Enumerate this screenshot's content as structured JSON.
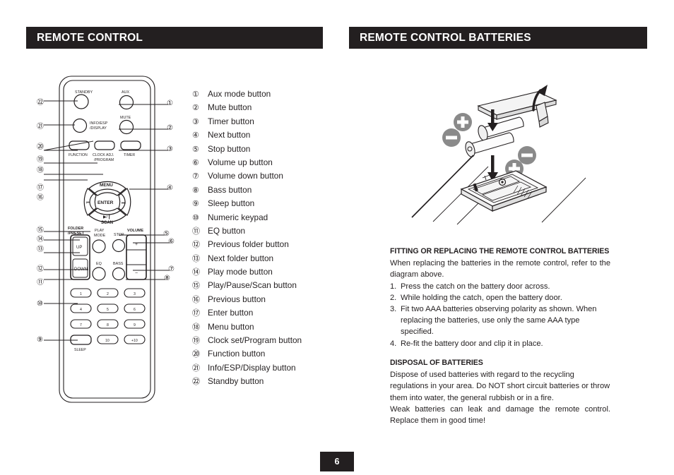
{
  "page": {
    "number": "6"
  },
  "sections": {
    "left_header": "REMOTE CONTROL",
    "right_header": "REMOTE CONTROL BATTERIES"
  },
  "legend": {
    "items": [
      {
        "num": "①",
        "label": "Aux mode button"
      },
      {
        "num": "②",
        "label": "Mute button"
      },
      {
        "num": "③",
        "label": "Timer button"
      },
      {
        "num": "④",
        "label": "Next button"
      },
      {
        "num": "⑤",
        "label": "Stop button"
      },
      {
        "num": "⑥",
        "label": "Volume up button"
      },
      {
        "num": "⑦",
        "label": "Volume down button"
      },
      {
        "num": "⑧",
        "label": "Bass button"
      },
      {
        "num": "⑨",
        "label": "Sleep button"
      },
      {
        "num": "⑩",
        "label": "Numeric keypad"
      },
      {
        "num": "⑪",
        "label": "EQ button"
      },
      {
        "num": "⑫",
        "label": "Previous folder button"
      },
      {
        "num": "⑬",
        "label": "Next folder button"
      },
      {
        "num": "⑭",
        "label": "Play mode button"
      },
      {
        "num": "⑮",
        "label": "Play/Pause/Scan button"
      },
      {
        "num": "⑯",
        "label": "Previous button"
      },
      {
        "num": "⑰",
        "label": "Enter button"
      },
      {
        "num": "⑱",
        "label": "Menu button"
      },
      {
        "num": "⑲",
        "label": "Clock set/Program button"
      },
      {
        "num": "⑳",
        "label": "Function button"
      },
      {
        "num": "㉑",
        "label": "Info/ESP/Display button"
      },
      {
        "num": "㉒",
        "label": "Standby button"
      }
    ]
  },
  "remote": {
    "buttons": {
      "standby": "STANDBY",
      "aux": "AUX",
      "info_display_line1": "INFO/ESP",
      "info_display_line2": "/DISPLAY",
      "mute": "MUTE",
      "function": "FUNCTION",
      "clock_line1": "CLOCK ADJ.",
      "clock_line2": "/PROGRAM",
      "timer": "TIMER",
      "menu": "MENU",
      "enter": "ENTER",
      "prev": "⏮",
      "next": "⏭",
      "play_pause": "▶/❙",
      "scan": "SCAN",
      "folder_line1": "FOLDER",
      "folder_line2": "/PRESET",
      "up": "UP",
      "down": "DOWN",
      "play_mode_line1": "PLAY",
      "play_mode_line2": "MODE",
      "stop": "STOP",
      "volume": "VOLUME",
      "vol_up": "+",
      "vol_down": "−",
      "eq": "EQ",
      "bass": "BASS",
      "sleep": "SLEEP",
      "key1": "1",
      "key2": "2",
      "key3": "3",
      "key4": "4",
      "key5": "5",
      "key6": "6",
      "key7": "7",
      "key8": "8",
      "key9": "9",
      "key10": "10",
      "keyplus10": "+10"
    },
    "callouts_left": [
      "㉒",
      "㉑",
      "⑳",
      "⑲",
      "⑱",
      "⑰",
      "⑯",
      "⑮",
      "⑭",
      "⑬",
      "⑫",
      "⑪",
      "⑩",
      "⑨"
    ],
    "callouts_right": [
      "①",
      "②",
      "③",
      "④",
      "⑤",
      "⑥",
      "⑦",
      "⑧"
    ]
  },
  "battery_diagram": {
    "plus_symbol": "+",
    "minus_symbol": "−"
  },
  "fitting": {
    "heading": "FITTING OR REPLACING THE REMOTE CONTROL BATTERIES",
    "intro": "When replacing the batteries in the remote control, refer to the diagram above.",
    "steps": [
      {
        "index": "1.",
        "text": "Press the catch on the battery door across."
      },
      {
        "index": "2.",
        "text": "While holding the catch, open the battery door."
      },
      {
        "index": "3.",
        "text": "Fit two AAA batteries observing polarity as shown. When replacing the batteries, use only the same AAA type specified."
      },
      {
        "index": "4.",
        "text": "Re-fit the battery door and clip it in place."
      }
    ]
  },
  "disposal": {
    "heading": "DISPOSAL OF BATTERIES",
    "paragraph1": "Dispose of used batteries with regard to the recycling regulations in your area. Do NOT short circuit batteries or throw them into water, the general rubbish or in a fire.",
    "paragraph2": "Weak batteries can leak and damage the remote control. Replace them in good time!"
  },
  "colors": {
    "bar_background": "#231f20",
    "bar_text": "#ffffff",
    "body_text": "#231f20"
  }
}
